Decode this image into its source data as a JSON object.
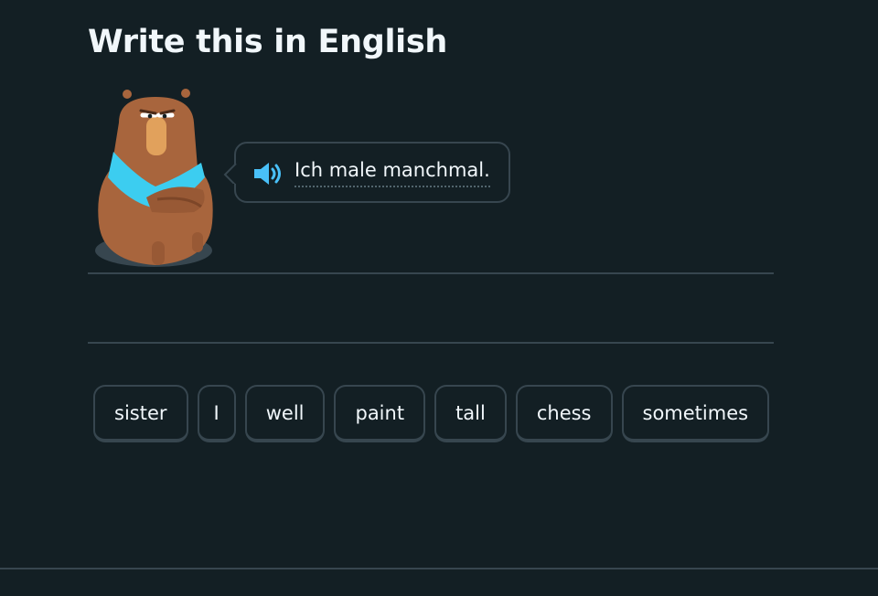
{
  "challenge": {
    "title": "Write this in English"
  },
  "prompt": {
    "text": "Ich male manchmal.",
    "audio_icon": "speaker-icon"
  },
  "character": {
    "icon": "bear-character"
  },
  "answer": {
    "selected_words": []
  },
  "word_bank": {
    "words": [
      "sister",
      "I",
      "well",
      "paint",
      "tall",
      "chess",
      "sometimes"
    ]
  },
  "colors": {
    "background": "#131f24",
    "border": "#37464f",
    "text": "#f1f7fb",
    "speaker": "#49c0f8",
    "bear_fur": "#a8653d",
    "bear_scarf": "#3ccdf0"
  }
}
